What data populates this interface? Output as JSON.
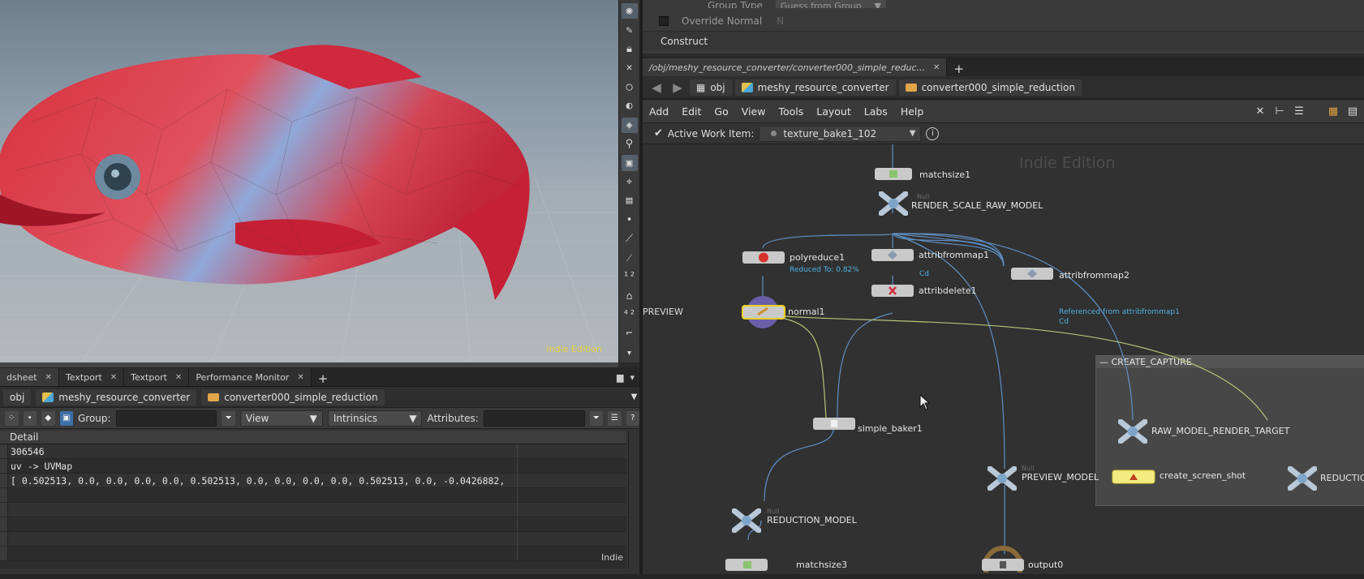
{
  "viewport": {
    "watermark": "Indie Edition"
  },
  "spreadsheet": {
    "tabs": [
      {
        "label": "dsheet",
        "active": true
      },
      {
        "label": "Textport"
      },
      {
        "label": "Textport"
      },
      {
        "label": "Performance Monitor"
      }
    ],
    "path": [
      "obj",
      "meshy_resource_converter",
      "converter000_simple_reduction"
    ],
    "frame_badge": "1",
    "filter": {
      "group_label": "Group:",
      "view_label": "View",
      "intrinsics_label": "Intrinsics",
      "attributes_label": "Attributes:"
    },
    "column": "Detail",
    "rows": [
      "306546",
      "uv -> UVMap",
      "[ 0.502513, 0.0, 0.0, 0.0, 0.0, 0.502513, 0.0, 0.0, 0.0, 0.0, 0.502513, 0.0, -0.0426882,",
      "",
      "",
      "",
      "",
      ""
    ],
    "indie": "Indie"
  },
  "params": {
    "group_type_label": "Group Type",
    "group_type_value": "Guess from Group",
    "override_normal_label": "Override Normal",
    "override_normal_value": "N",
    "construct_label": "Construct"
  },
  "network": {
    "tab_label": "/obj/meshy_resource_converter/converter000_simple_reduc...",
    "path": [
      "obj",
      "meshy_resource_converter",
      "converter000_simple_reduction"
    ],
    "menu": [
      "Add",
      "Edit",
      "Go",
      "View",
      "Tools",
      "Layout",
      "Labs",
      "Help"
    ],
    "work_item_label": "Active Work Item:",
    "work_item_value": "texture_bake1_102",
    "watermark": "Indie Edition",
    "preview_label": "PREVIEW",
    "capture_title": "CREATE_CAPTURE",
    "nodes": {
      "matchsize1": "matchsize1",
      "render_scale": "RENDER_SCALE_RAW_MODEL",
      "polyreduce1": "polyreduce1",
      "polyreduce1_sub": "Reduced To: 0.82%",
      "attribfrommap1": "attribfrommap1",
      "attribfrommap1_sub": "Cd",
      "attribdelete1": "attribdelete1",
      "attribfrommap2": "attribfrommap2",
      "attribfrommap2_sub1": "Referenced from attribfrommap1",
      "attribfrommap2_sub2": "Cd",
      "normal1": "normal1",
      "simple_baker1": "simple_baker1",
      "raw_model_target": "RAW_MODEL_RENDER_TARGET",
      "create_screen_shot": "create_screen_shot",
      "reduction_cut": "REDUCTION",
      "preview_model": "PREVIEW_MODEL",
      "reduction_model": "REDUCTION_MODEL",
      "matchsize3": "matchsize3",
      "output0": "output0",
      "null_type": "Null"
    }
  }
}
